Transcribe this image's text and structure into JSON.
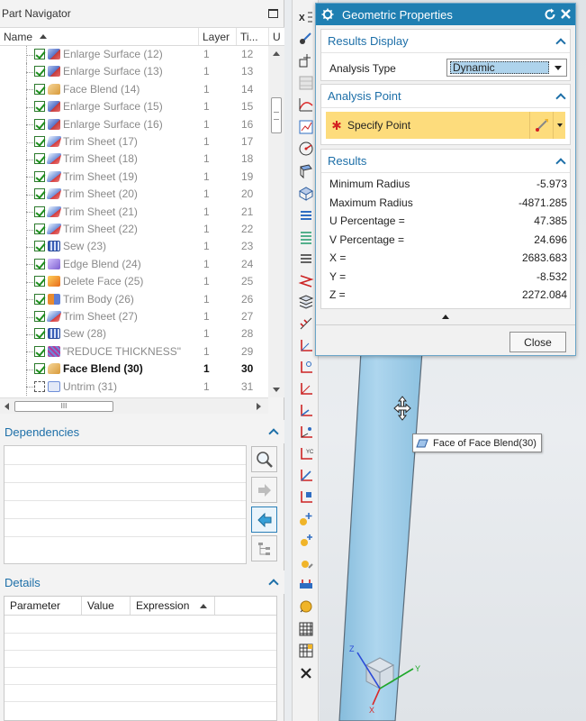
{
  "navigator": {
    "title": "Part Navigator",
    "columns": {
      "name": "Name",
      "layer": "Layer",
      "time": "Ti...",
      "u": "U"
    },
    "hscroll_label": "III",
    "rows": [
      {
        "name": "Enlarge Surface (12)",
        "layer": "1",
        "time": "12",
        "icon": "enlarge-surface-icon",
        "state": "suppressed"
      },
      {
        "name": "Enlarge Surface (13)",
        "layer": "1",
        "time": "13",
        "icon": "enlarge-surface-icon",
        "state": "suppressed"
      },
      {
        "name": "Face Blend (14)",
        "layer": "1",
        "time": "14",
        "icon": "face-blend-icon",
        "state": "suppressed"
      },
      {
        "name": "Enlarge Surface (15)",
        "layer": "1",
        "time": "15",
        "icon": "enlarge-surface-icon",
        "state": "suppressed"
      },
      {
        "name": "Enlarge Surface (16)",
        "layer": "1",
        "time": "16",
        "icon": "enlarge-surface-icon",
        "state": "suppressed"
      },
      {
        "name": "Trim Sheet (17)",
        "layer": "1",
        "time": "17",
        "icon": "trim-sheet-icon",
        "state": "suppressed"
      },
      {
        "name": "Trim Sheet (18)",
        "layer": "1",
        "time": "18",
        "icon": "trim-sheet-icon",
        "state": "suppressed"
      },
      {
        "name": "Trim Sheet (19)",
        "layer": "1",
        "time": "19",
        "icon": "trim-sheet-icon",
        "state": "suppressed"
      },
      {
        "name": "Trim Sheet (20)",
        "layer": "1",
        "time": "20",
        "icon": "trim-sheet-icon",
        "state": "suppressed"
      },
      {
        "name": "Trim Sheet (21)",
        "layer": "1",
        "time": "21",
        "icon": "trim-sheet-icon",
        "state": "suppressed"
      },
      {
        "name": "Trim Sheet (22)",
        "layer": "1",
        "time": "22",
        "icon": "trim-sheet-icon",
        "state": "suppressed"
      },
      {
        "name": "Sew (23)",
        "layer": "1",
        "time": "23",
        "icon": "sew-icon",
        "state": "suppressed"
      },
      {
        "name": "Edge Blend (24)",
        "layer": "1",
        "time": "24",
        "icon": "edge-blend-icon",
        "state": "suppressed"
      },
      {
        "name": "Delete Face (25)",
        "layer": "1",
        "time": "25",
        "icon": "delete-face-icon",
        "state": "suppressed"
      },
      {
        "name": "Trim Body (26)",
        "layer": "1",
        "time": "26",
        "icon": "trim-body-icon",
        "state": "suppressed"
      },
      {
        "name": "Trim Sheet (27)",
        "layer": "1",
        "time": "27",
        "icon": "trim-sheet-icon",
        "state": "suppressed"
      },
      {
        "name": "Sew (28)",
        "layer": "1",
        "time": "28",
        "icon": "sew-icon",
        "state": "suppressed"
      },
      {
        "name": "\"REDUCE THICKNESS\"",
        "layer": "1",
        "time": "29",
        "icon": "udf-icon",
        "state": "suppressed"
      },
      {
        "name": "Face Blend (30)",
        "layer": "1",
        "time": "30",
        "icon": "face-blend-icon",
        "state": "active"
      },
      {
        "name": "Untrim (31)",
        "layer": "1",
        "time": "31",
        "icon": "untrim-icon",
        "state": "unchecked"
      }
    ]
  },
  "dependencies": {
    "title": "Dependencies"
  },
  "details": {
    "title": "Details",
    "columns": {
      "parameter": "Parameter",
      "value": "Value",
      "expression": "Expression"
    }
  },
  "dialog": {
    "title": "Geometric Properties",
    "results_display": {
      "title": "Results Display",
      "analysis_type_label": "Analysis Type",
      "analysis_type_value": "Dynamic"
    },
    "analysis_point": {
      "title": "Analysis Point",
      "specify_point_label": "Specify Point"
    },
    "results": {
      "title": "Results",
      "items": [
        {
          "label": "Minimum Radius",
          "value": "-5.973"
        },
        {
          "label": "Maximum Radius",
          "value": "-4871.285"
        },
        {
          "label": "U Percentage =",
          "value": "47.385"
        },
        {
          "label": "V Percentage =",
          "value": "24.696"
        },
        {
          "label": "X =",
          "value": "2683.683"
        },
        {
          "label": "Y =",
          "value": "-8.532"
        },
        {
          "label": "Z =",
          "value": "2272.084"
        }
      ]
    },
    "close_label": "Close"
  },
  "viewport": {
    "tooltip": "Face of Face Blend(30)",
    "triad_labels": {
      "z": "Z",
      "y": "Y",
      "x": "X"
    }
  },
  "colors": {
    "dialog_title_bar": "#1f7fb2",
    "section_heading": "#1d6fa8",
    "specify_point_highlight": "#fddc7c",
    "tube_fill": "#a9d3ea",
    "checkbox_green": "#1d8f1d"
  }
}
